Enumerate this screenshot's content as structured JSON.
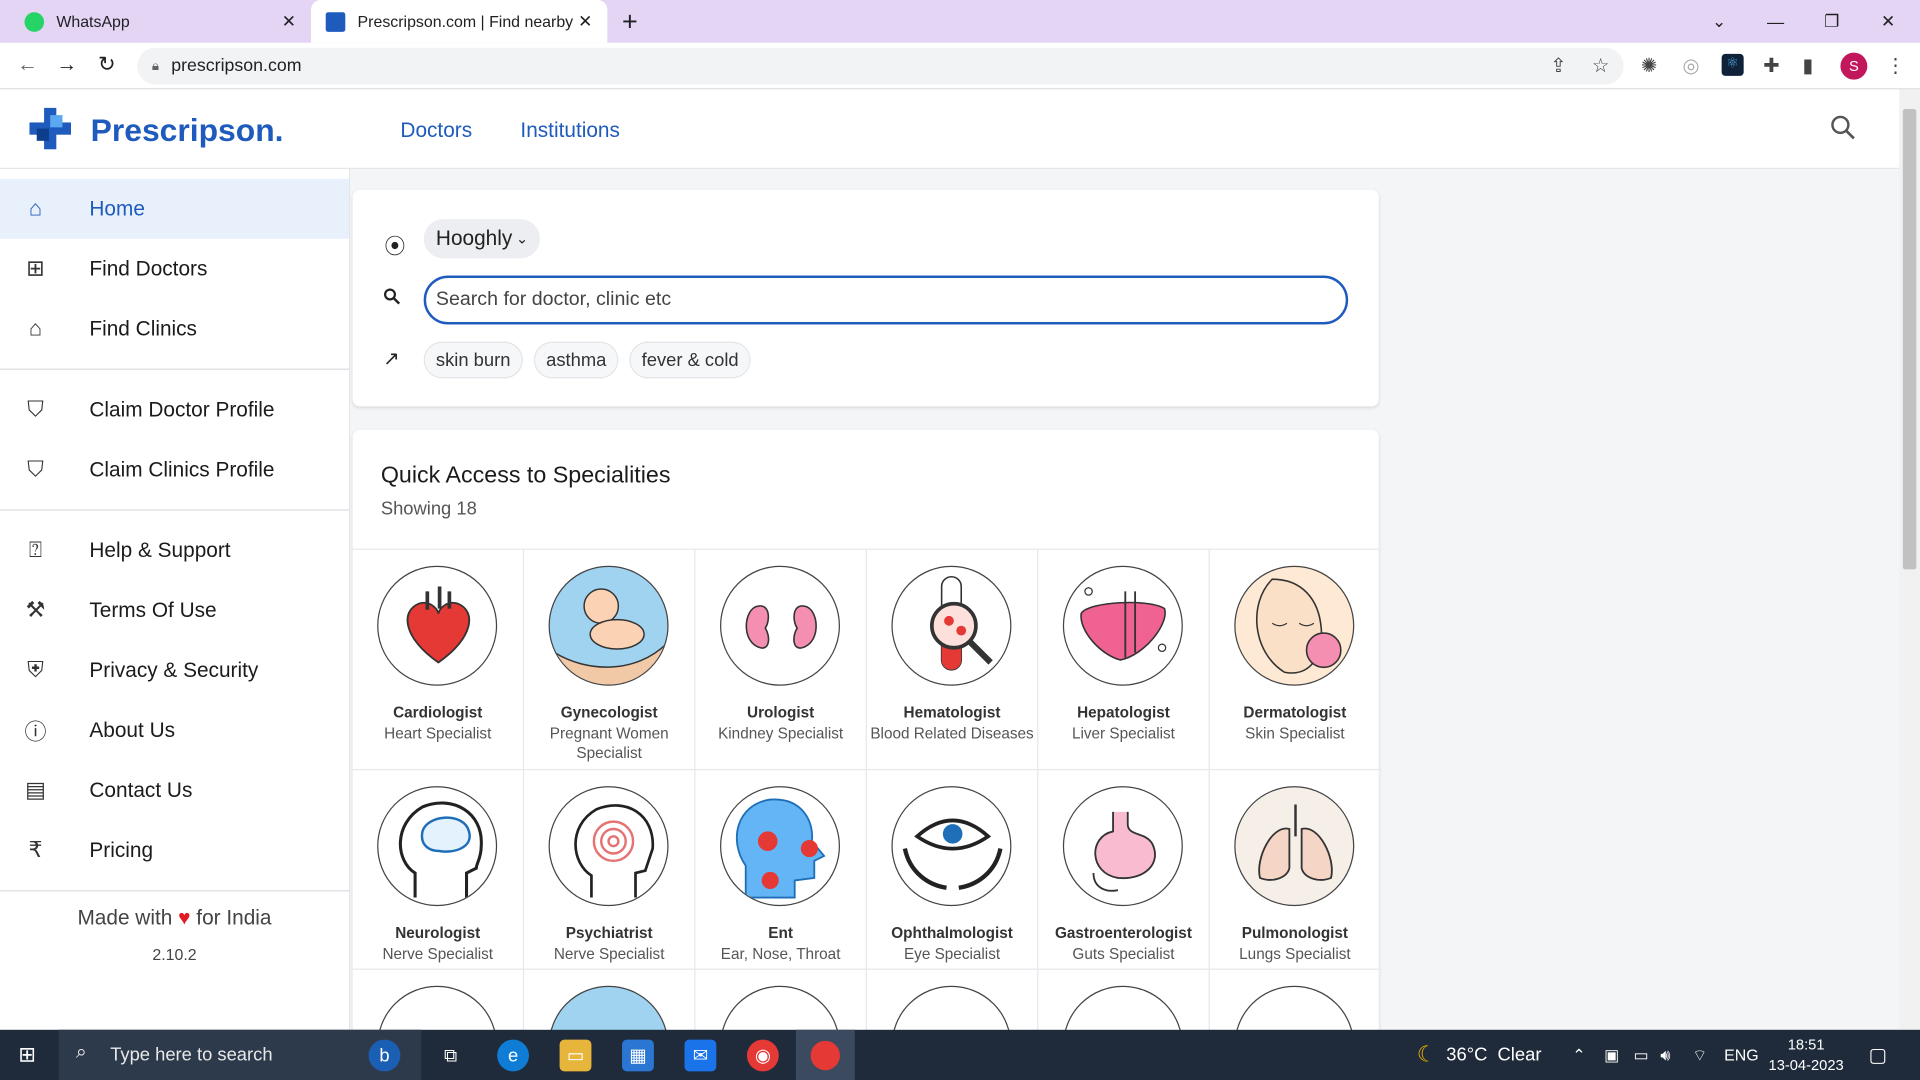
{
  "browser": {
    "tabs": [
      {
        "title": "WhatsApp",
        "favicon_color": "#25d366"
      },
      {
        "title": "Prescripson.com | Find nearby do",
        "favicon_color": "#1f5bbd"
      }
    ],
    "url": "prescripson.com",
    "profile_initial": "S"
  },
  "header": {
    "brand": "Prescripson.",
    "nav": [
      "Doctors",
      "Institutions"
    ]
  },
  "sidebar": {
    "items": [
      {
        "label": "Home",
        "icon": "home-icon"
      },
      {
        "label": "Find Doctors",
        "icon": "medical-bag-icon"
      },
      {
        "label": "Find Clinics",
        "icon": "clinic-icon"
      },
      {
        "label": "Claim Doctor Profile",
        "icon": "profile-badge-icon"
      },
      {
        "label": "Claim Clinics Profile",
        "icon": "profile-badge-icon"
      },
      {
        "label": "Help & Support",
        "icon": "help-icon"
      },
      {
        "label": "Terms Of Use",
        "icon": "gavel-icon"
      },
      {
        "label": "Privacy & Security",
        "icon": "shield-icon"
      },
      {
        "label": "About Us",
        "icon": "info-icon"
      },
      {
        "label": "Contact Us",
        "icon": "contact-card-icon"
      },
      {
        "label": "Pricing",
        "icon": "rupee-icon"
      }
    ],
    "made_with_prefix": "Made with",
    "made_with_suffix": "for India",
    "version": "2.10.2"
  },
  "search": {
    "city": "Hooghly",
    "placeholder": "Search for doctor, clinic etc",
    "trending": [
      "skin burn",
      "asthma",
      "fever & cold"
    ]
  },
  "specialities": {
    "title": "Quick Access to Specialities",
    "count_text": "Showing 18",
    "items": [
      {
        "name": "Cardiologist",
        "desc": "Heart Specialist"
      },
      {
        "name": "Gynecologist",
        "desc": "Pregnant Women Specialist"
      },
      {
        "name": "Urologist",
        "desc": "Kindney Specialist"
      },
      {
        "name": "Hematologist",
        "desc": "Blood Related Diseases"
      },
      {
        "name": "Hepatologist",
        "desc": "Liver Specialist"
      },
      {
        "name": "Dermatologist",
        "desc": "Skin Specialist"
      },
      {
        "name": "Neurologist",
        "desc": "Nerve Specialist"
      },
      {
        "name": "Psychiatrist",
        "desc": "Nerve Specialist"
      },
      {
        "name": "Ent",
        "desc": "Ear, Nose, Throat"
      },
      {
        "name": "Ophthalmologist",
        "desc": "Eye Specialist"
      },
      {
        "name": "Gastroenterologist",
        "desc": "Guts Specialist"
      },
      {
        "name": "Pulmonologist",
        "desc": "Lungs Specialist"
      }
    ]
  },
  "taskbar": {
    "search_placeholder": "Type here to search",
    "weather": "36°C  Clear",
    "language": "ENG",
    "time": "18:51",
    "date": "13-04-2023"
  },
  "colors": {
    "brand": "#1f5bbd",
    "heart": "#e01b24",
    "taskbar": "#1f2b3a"
  }
}
